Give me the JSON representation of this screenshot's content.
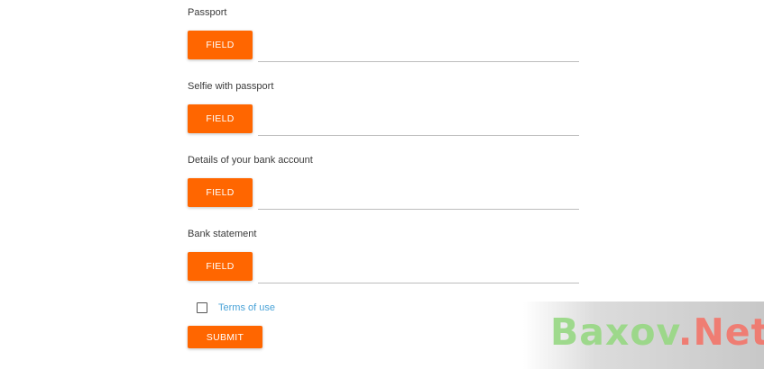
{
  "form": {
    "fields": [
      {
        "label": "Passport",
        "button_label": "FIELD"
      },
      {
        "label": "Selfie with passport",
        "button_label": "FIELD"
      },
      {
        "label": "Details of your bank account",
        "button_label": "FIELD"
      },
      {
        "label": "Bank statement",
        "button_label": "FIELD"
      }
    ],
    "terms_label": "Terms of use",
    "submit_label": "SUBMIT"
  },
  "watermark": {
    "part1": "Baxov",
    "part2": ".Net"
  },
  "colors": {
    "accent": "#ff6600",
    "link": "#4aa3d8"
  }
}
